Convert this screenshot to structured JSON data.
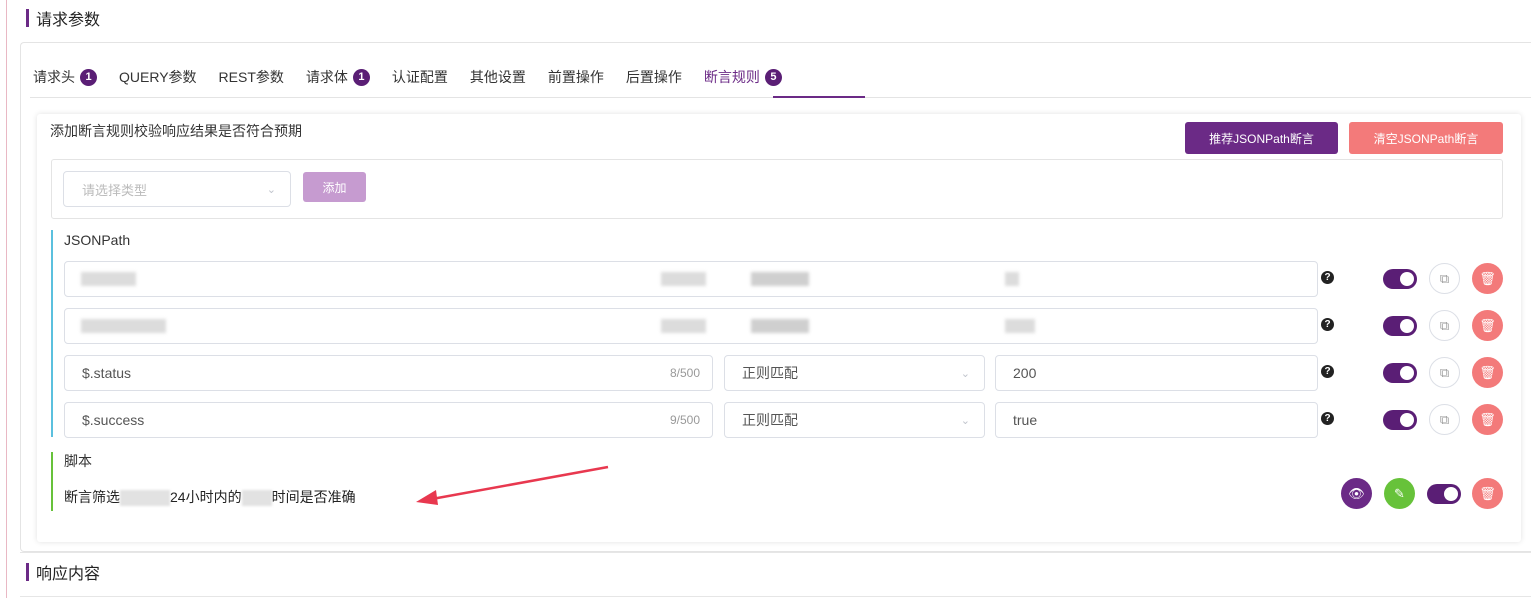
{
  "sections": {
    "request_params": "请求参数",
    "response_content": "响应内容"
  },
  "tabs": [
    {
      "label": "请求头",
      "badge": "1"
    },
    {
      "label": "QUERY参数",
      "badge": ""
    },
    {
      "label": "REST参数",
      "badge": ""
    },
    {
      "label": "请求体",
      "badge": "1"
    },
    {
      "label": "认证配置",
      "badge": ""
    },
    {
      "label": "其他设置",
      "badge": ""
    },
    {
      "label": "前置操作",
      "badge": ""
    },
    {
      "label": "后置操作",
      "badge": ""
    },
    {
      "label": "断言规则",
      "badge": "5"
    }
  ],
  "active_tab": "断言规则",
  "assertion": {
    "hint": "添加断言规则校验响应结果是否符合预期",
    "recommend_button": "推荐JSONPath断言",
    "clear_button": "清空JSONPath断言",
    "type_placeholder": "请选择类型",
    "add_button": "添加"
  },
  "jsonpath": {
    "label": "JSONPath",
    "rows": [
      {
        "path": "$.status",
        "count": "8/500",
        "match": "正则匹配",
        "value": "200",
        "enabled": true
      },
      {
        "path": "$.success",
        "count": "9/500",
        "match": "正则匹配",
        "value": "true",
        "enabled": true
      }
    ]
  },
  "script": {
    "label": "脚本",
    "text_a": "断言筛选",
    "text_b": "24小时内的",
    "text_c": "时间是否准确",
    "enabled": true
  },
  "icons": {
    "help": "question-circle-icon",
    "copy": "copy-icon",
    "delete": "trash-icon",
    "view": "eye-icon",
    "edit": "pencil-icon"
  },
  "colors": {
    "primary": "#6b2a86",
    "danger": "#f37a7a",
    "success": "#67c23a",
    "info": "#5bc0de"
  }
}
